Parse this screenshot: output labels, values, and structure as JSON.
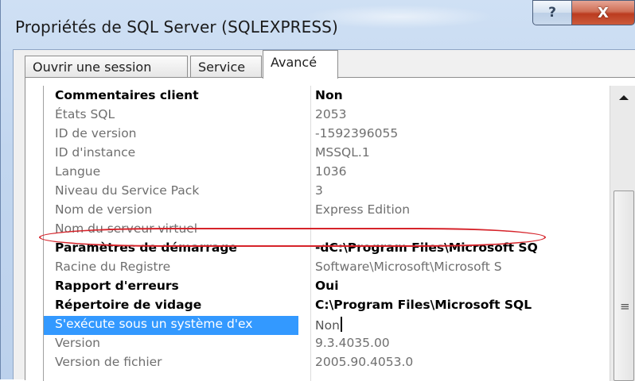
{
  "window": {
    "title": "Propriétés de SQL Server (SQLEXPRESS)",
    "help_label": "?",
    "close_label": "X"
  },
  "tabs": [
    {
      "label": "Ouvrir une session",
      "active": false
    },
    {
      "label": "Service",
      "active": false
    },
    {
      "label": "Avancé",
      "active": true
    }
  ],
  "properties": [
    {
      "name": "Commentaires client",
      "value": "Non",
      "style": "bold"
    },
    {
      "name": "États SQL",
      "value": "2053",
      "style": "dim"
    },
    {
      "name": "ID de version",
      "value": "-1592396055",
      "style": "dim"
    },
    {
      "name": "ID d'instance",
      "value": "MSSQL.1",
      "style": "dim"
    },
    {
      "name": "Langue",
      "value": "1036",
      "style": "dim"
    },
    {
      "name": "Niveau du Service Pack",
      "value": "3",
      "style": "dim"
    },
    {
      "name": "Nom de version",
      "value": "Express Edition",
      "style": "dim"
    },
    {
      "name": "Nom du serveur virtuel",
      "value": "",
      "style": "dim"
    },
    {
      "name": "Paramètres de démarrage",
      "value": "-dC:\\Program Files\\Microsoft SQ",
      "style": "bold"
    },
    {
      "name": "Racine du Registre",
      "value": "Software\\Microsoft\\Microsoft S",
      "style": "dim"
    },
    {
      "name": "Rapport d'erreurs",
      "value": "Oui",
      "style": "bold"
    },
    {
      "name": "Répertoire de vidage",
      "value": "C:\\Program Files\\Microsoft SQL",
      "style": "bold"
    },
    {
      "name": "S'exécute sous un système d'ex",
      "value": "Non",
      "style": "selected"
    },
    {
      "name": "Version",
      "value": "9.3.4035.00",
      "style": "dim"
    },
    {
      "name": "Version de fichier",
      "value": "2005.90.4053.0",
      "style": "dim"
    }
  ],
  "scrollbar": {
    "grip_symbol": "≡"
  },
  "colors": {
    "selection": "#3399ff",
    "annotation": "#d6232a",
    "close_button": "#c2462a"
  }
}
